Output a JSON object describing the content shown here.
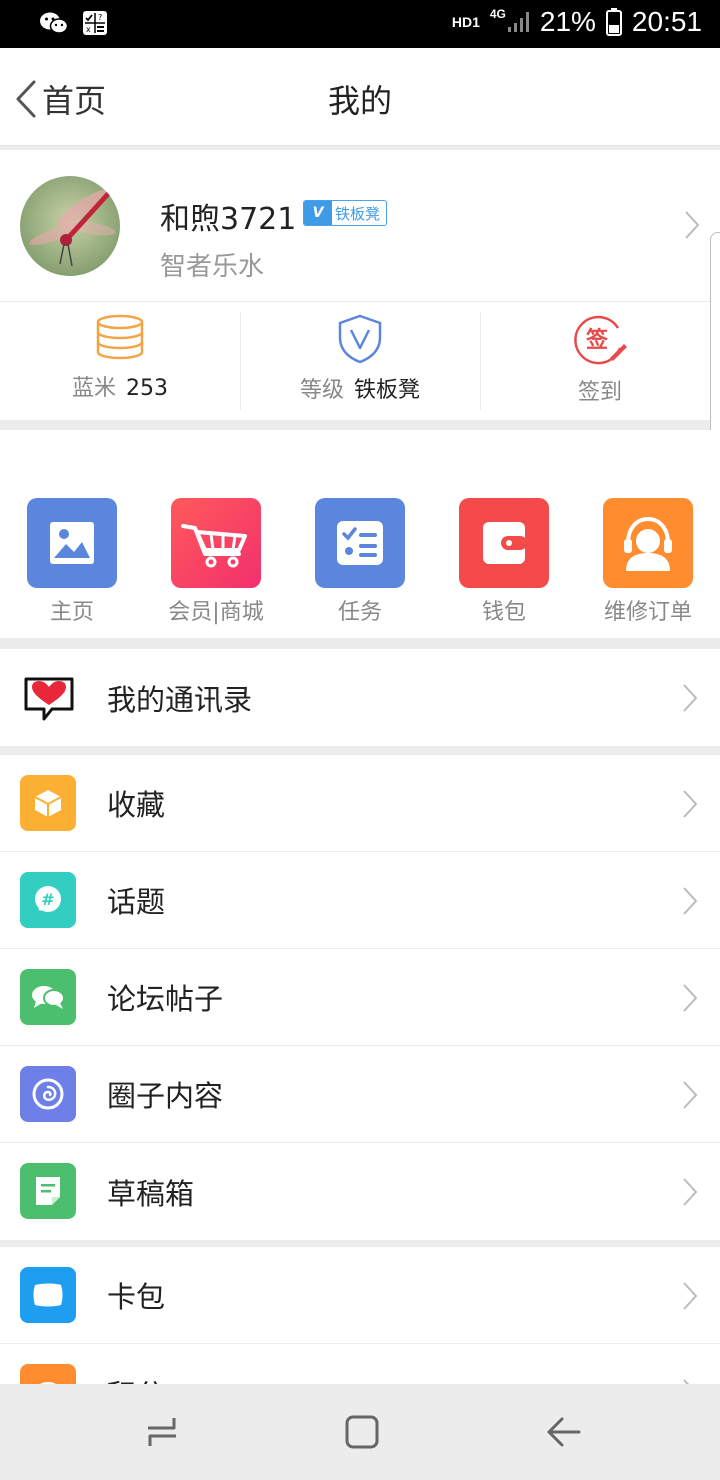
{
  "status_bar": {
    "left_icons": [
      "wechat-icon",
      "calculator-app-icon"
    ],
    "hd_label": "HD1",
    "network_label": "4G",
    "battery_percent": "21%",
    "time": "20:51"
  },
  "header": {
    "back_label": "首页",
    "title": "我的"
  },
  "profile": {
    "username": "和煦3721",
    "badge_text": "铁板凳",
    "badge_mark": "V",
    "signature": "智者乐水"
  },
  "stats": [
    {
      "label": "蓝米",
      "value": "253",
      "icon": "coins-stack-icon"
    },
    {
      "label": "等级",
      "value": "铁板凳",
      "icon": "shield-v-icon"
    },
    {
      "label": "签到",
      "value": "",
      "icon_text": "签",
      "icon": "sign-in-icon"
    }
  ],
  "shortcuts": [
    {
      "label": "主页",
      "icon": "image-icon",
      "color": "#5b86dd"
    },
    {
      "label": "会员|商城",
      "icon": "shopping-cart-icon",
      "color": "#f2406a"
    },
    {
      "label": "任务",
      "icon": "checklist-icon",
      "color": "#5b86dd"
    },
    {
      "label": "钱包",
      "icon": "wallet-icon",
      "color": "#f54a4a"
    },
    {
      "label": "维修订单",
      "icon": "customer-service-icon",
      "color": "#ff8c2f"
    }
  ],
  "contacts_row": {
    "label": "我的通讯录",
    "icon": "heart-chat-icon"
  },
  "content_rows": [
    {
      "label": "收藏",
      "icon": "box-icon",
      "color": "#fbb033"
    },
    {
      "label": "话题",
      "icon": "hashtag-chat-icon",
      "color": "#31cec1"
    },
    {
      "label": "论坛帖子",
      "icon": "chat-bubbles-icon",
      "color": "#4cbf6e"
    },
    {
      "label": "圈子内容",
      "icon": "swirl-circle-icon",
      "color": "#6e80e8"
    },
    {
      "label": "草稿箱",
      "icon": "document-icon",
      "color": "#4cbf6e"
    }
  ],
  "wallet_rows": [
    {
      "label": "卡包",
      "icon": "card-icon",
      "color": "#1e9ef0"
    },
    {
      "label": "积分",
      "icon": "points-icon",
      "color": "#ff8c2f"
    }
  ],
  "colors": {
    "accent_blue": "#3f9be5",
    "stat_orange": "#f5a347",
    "sign_red": "#e84a4a"
  }
}
